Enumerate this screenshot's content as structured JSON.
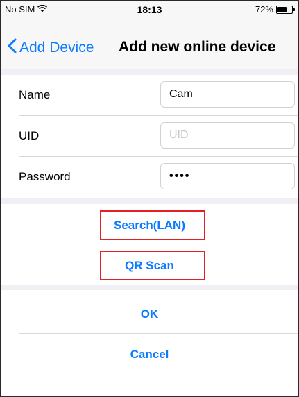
{
  "status_bar": {
    "carrier": "No SIM",
    "time": "18:13",
    "battery": "72%",
    "battery_level": 0.72,
    "icons": [
      "wifi-icon",
      "battery-icon"
    ]
  },
  "nav": {
    "back_label": "Add Device",
    "title": "Add new online device"
  },
  "form": {
    "name_label": "Name",
    "name_value": "Cam",
    "uid_label": "UID",
    "uid_placeholder": "UID",
    "uid_value": "",
    "password_label": "Password",
    "password_value": "••••"
  },
  "actions": {
    "search_label": "Search(LAN)",
    "qr_label": "QR Scan",
    "ok_label": "OK",
    "cancel_label": "Cancel"
  },
  "colors": {
    "accent": "#0a7aff",
    "highlight": "#e51f26",
    "background": "#efeff4"
  }
}
